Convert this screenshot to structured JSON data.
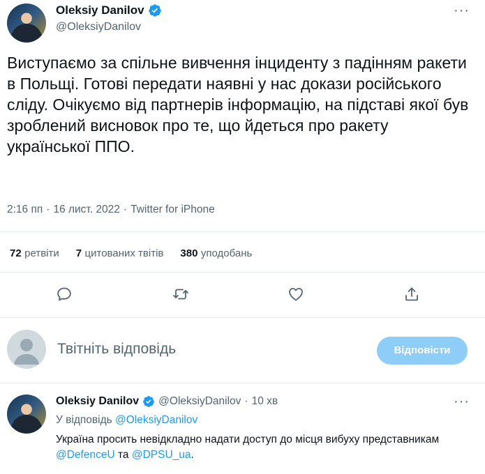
{
  "main_tweet": {
    "author_name": "Oleksiy Danilov",
    "author_handle": "@OleksiyDanilov",
    "more_label": "···",
    "text": "Виступаємо за спільне вивчення інциденту з падінням ракети в Польщі. Готові передати наявні у нас докази російського сліду. Очікуємо від партнерів інформацію, на підставі якої був зроблений висновок про те, що йдеться про ракету української ППО.",
    "time": "2:16 пп",
    "date": "16 лист. 2022",
    "source": "Twitter for iPhone",
    "separator": "·"
  },
  "stats": {
    "retweets_count": "72",
    "retweets_label": "ретвіти",
    "quotes_count": "7",
    "quotes_label": "цитованих твітів",
    "likes_count": "380",
    "likes_label": "уподобань"
  },
  "actions": {
    "icons": [
      "reply-icon",
      "retweet-icon",
      "like-icon",
      "share-icon"
    ]
  },
  "reply_composer": {
    "placeholder": "Твітніть відповідь",
    "button_label": "Відповісти"
  },
  "reply_tweet": {
    "author_name": "Oleksiy Danilov",
    "author_handle": "@OleksiyDanilov",
    "separator": "·",
    "time_ago": "10 хв",
    "more_label": "···",
    "reply_to_label": "У відповідь",
    "reply_to_handle": "@OleksiyDanilov",
    "text_part1": "Україна просить невідкладно надати доступ до місця вибуху представникам",
    "mention1": "@DefenceU",
    "text_part2": "та",
    "mention2": "@DPSU_ua",
    "text_end": "."
  },
  "colors": {
    "accent": "#1d9bf0",
    "button_disabled": "#8ecdf8",
    "secondary_text": "#536471",
    "divider": "#e6ecf0"
  }
}
